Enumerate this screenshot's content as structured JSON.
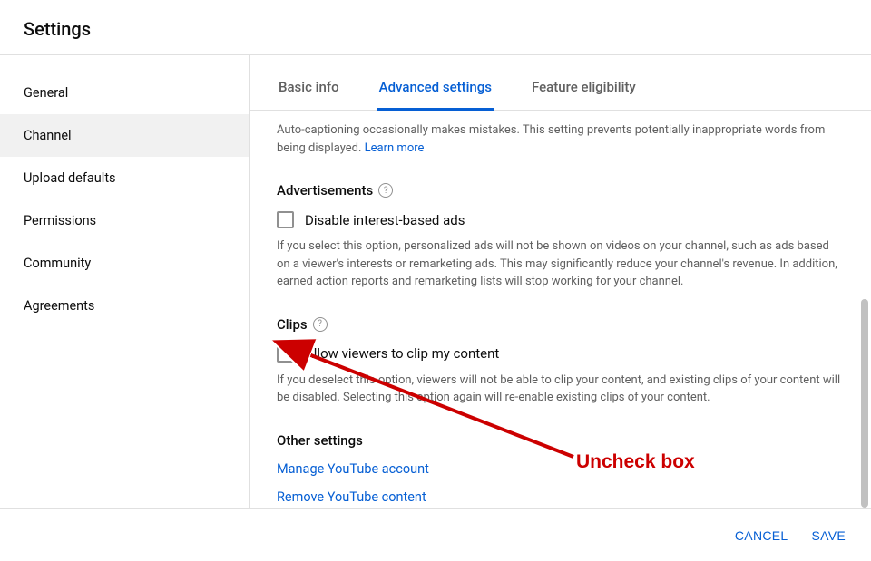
{
  "header": {
    "title": "Settings"
  },
  "sidebar": {
    "items": [
      {
        "label": "General"
      },
      {
        "label": "Channel"
      },
      {
        "label": "Upload defaults"
      },
      {
        "label": "Permissions"
      },
      {
        "label": "Community"
      },
      {
        "label": "Agreements"
      }
    ]
  },
  "tabs": {
    "items": [
      {
        "label": "Basic info"
      },
      {
        "label": "Advanced settings"
      },
      {
        "label": "Feature eligibility"
      }
    ]
  },
  "autocaption": {
    "description": "Auto-captioning occasionally makes mistakes. This setting prevents potentially inappropriate words from being displayed. ",
    "learn_more": "Learn more"
  },
  "advertisements": {
    "title": "Advertisements",
    "checkbox_label": "Disable interest-based ads",
    "description": "If you select this option, personalized ads will not be shown on videos on your channel, such as ads based on a viewer's interests or remarketing ads. This may significantly reduce your channel's revenue. In addition, earned action reports and remarketing lists will stop working for your channel."
  },
  "clips": {
    "title": "Clips",
    "checkbox_label": "Allow viewers to clip my content",
    "description": "If you deselect this option, viewers will not be able to clip your content, and existing clips of your content will be disabled. Selecting this option again will re-enable existing clips of your content."
  },
  "other_settings": {
    "title": "Other settings",
    "links": [
      {
        "label": "Manage YouTube account"
      },
      {
        "label": "Remove YouTube content"
      }
    ]
  },
  "footer": {
    "cancel": "CANCEL",
    "save": "SAVE"
  },
  "annotation": {
    "text": "Uncheck box"
  }
}
